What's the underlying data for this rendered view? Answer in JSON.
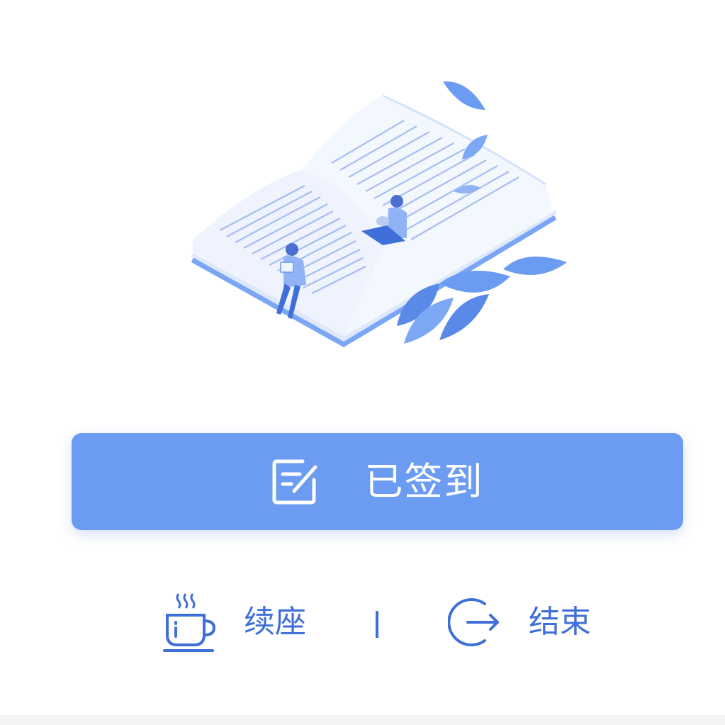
{
  "colors": {
    "accent": "#6b9cf2",
    "accent_dark": "#5a7fe0",
    "icon_blue": "#3f6fd8",
    "illustration_light": "#e8effc",
    "illustration_mid": "#b9cdf4"
  },
  "illustration": {
    "icon": "open-book-reading-illustration"
  },
  "checkin": {
    "label": "已签到",
    "icon": "edit-note-icon"
  },
  "actions": {
    "renew": {
      "label": "续座",
      "icon": "coffee-cup-icon"
    },
    "end": {
      "label": "结束",
      "icon": "exit-arrow-icon"
    }
  }
}
